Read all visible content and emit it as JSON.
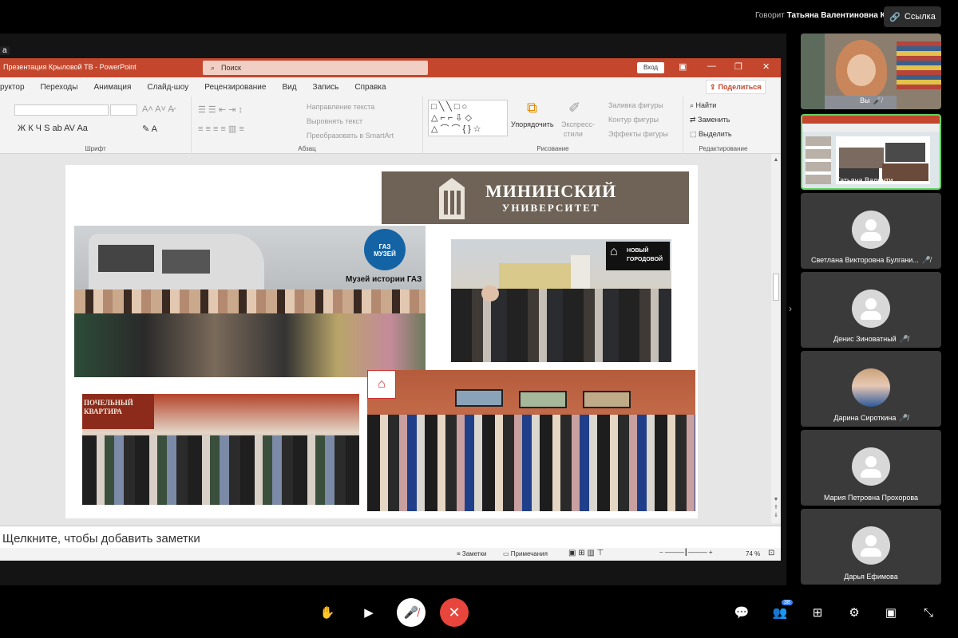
{
  "meeting": {
    "speaking_prefix": "Говорит",
    "speaking_name": "Татьяна Валентиновна К.",
    "link_label": "Ссылка",
    "share_tag": "а"
  },
  "ppt": {
    "title": "Презентация Крыловой ТВ  -  PowerPoint",
    "search_placeholder": "Поиск",
    "signin": "Вход",
    "share_label": "Поделиться",
    "menu": [
      "руктор",
      "Переходы",
      "Анимация",
      "Слайд-шоу",
      "Рецензирование",
      "Вид",
      "Запись",
      "Справка"
    ],
    "groups": {
      "font": "Шрифт",
      "paragraph": "Абзац",
      "drawing": "Рисование",
      "editing": "Редактирование"
    },
    "paragraph_items": [
      "Направление текста",
      "Выровнять текст",
      "Преобразовать в SmartArt"
    ],
    "drawing_items": [
      "Упорядочить",
      "Экспресс-",
      "стили",
      "Заливка фигуры",
      "Контур фигуры",
      "Эффекты фигуры"
    ],
    "editing_items": [
      "Найти",
      "Заменить",
      "Выделить"
    ],
    "notes_placeholder": "Щелкните, чтобы добавить заметки",
    "status": {
      "notes": "Заметки",
      "comments": "Примечания",
      "zoom": "74 %"
    }
  },
  "slide": {
    "logo_line1": "МИНИНСКИЙ",
    "logo_line2": "УНИВЕРСИТЕТ",
    "museum_caption": "Музей истории ГАЗ",
    "gaz_badge_top": "ГАЗ",
    "gaz_badge_bottom": "МУЗЕЙ",
    "novy_line1": "НОВЫЙ",
    "novy_line2": "ГОРОДОВОЙ",
    "sign_line1": "ПОЧЕЛЬНЫЙ",
    "sign_line2": "КВАРТИРА"
  },
  "participants": [
    {
      "name": "Вы",
      "muted": true,
      "type": "video"
    },
    {
      "name": "Татьяна Валенти...",
      "muted": false,
      "type": "screen"
    },
    {
      "name": "Светлана Викторовна Булгани...",
      "muted": true,
      "type": "avatar"
    },
    {
      "name": "Денис Зиноватный",
      "muted": true,
      "type": "avatar"
    },
    {
      "name": "Дарина Сироткина",
      "muted": true,
      "type": "photo"
    },
    {
      "name": "Мария Петровна Прохорова",
      "muted": false,
      "type": "avatar"
    },
    {
      "name": "Дарья Ефимова",
      "muted": false,
      "type": "avatar"
    }
  ],
  "controls": {
    "participants_count": "38"
  },
  "colors": {
    "ppt_accent": "#c4472d",
    "end_call": "#e8453c",
    "active_tile_border": "#5fd35f"
  }
}
